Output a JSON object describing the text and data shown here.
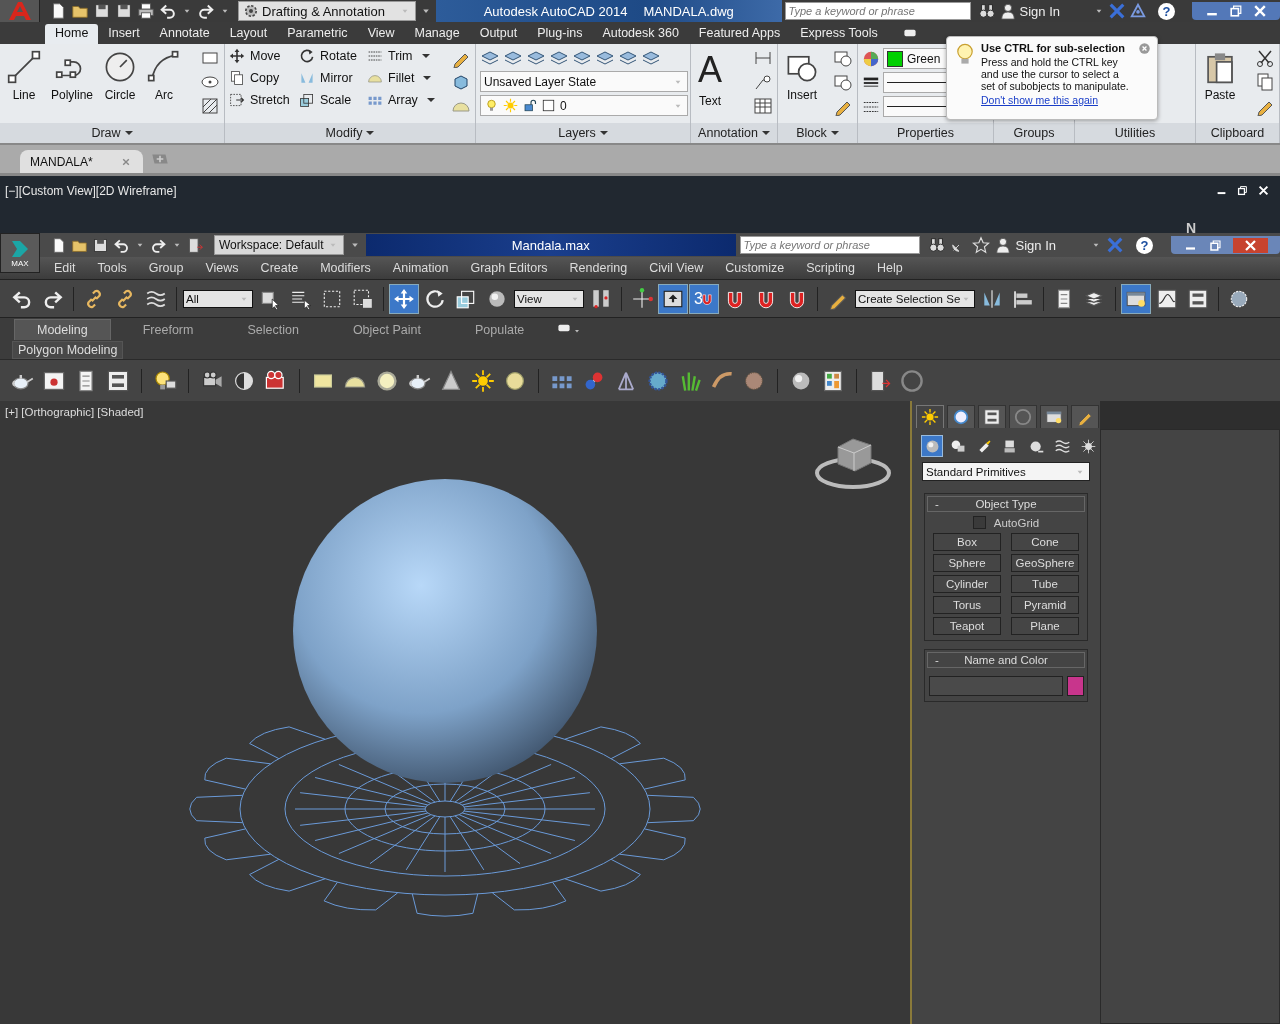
{
  "autocad": {
    "workspace": "Drafting & Annotation",
    "title": "Autodesk AutoCAD 2014",
    "filename": "MANDALA.dwg",
    "search": {
      "placeholder": "Type a keyword or phrase"
    },
    "sign_in": "Sign In",
    "help": "?",
    "ribbon_tabs": [
      {
        "label": "Home",
        "selected": true
      },
      {
        "label": "Insert",
        "selected": false
      },
      {
        "label": "Annotate",
        "selected": false
      },
      {
        "label": "Layout",
        "selected": false
      },
      {
        "label": "Parametric",
        "selected": false
      },
      {
        "label": "View",
        "selected": false
      },
      {
        "label": "Manage",
        "selected": false
      },
      {
        "label": "Output",
        "selected": false
      },
      {
        "label": "Plug-ins",
        "selected": false
      },
      {
        "label": "Autodesk 360",
        "selected": false
      },
      {
        "label": "Featured Apps",
        "selected": false
      },
      {
        "label": "Express Tools",
        "selected": false
      }
    ],
    "draw": {
      "title": "Draw",
      "tools": [
        "Line",
        "Polyline",
        "Circle",
        "Arc"
      ]
    },
    "modify": {
      "title": "Modify",
      "tools": [
        {
          "label": "Move",
          "menu": false
        },
        {
          "label": "Rotate",
          "menu": false
        },
        {
          "label": "Trim",
          "menu": true
        },
        {
          "label": "Copy",
          "menu": false
        },
        {
          "label": "Mirror",
          "menu": false
        },
        {
          "label": "Fillet",
          "menu": true
        },
        {
          "label": "Stretch",
          "menu": false
        },
        {
          "label": "Scale",
          "menu": false
        },
        {
          "label": "Array",
          "menu": true
        }
      ]
    },
    "layers": {
      "title": "Layers",
      "layer_state": "Unsaved Layer State",
      "current_layer": "0"
    },
    "annotation": {
      "title": "Annotation",
      "glyph": "A",
      "tool": "Text"
    },
    "block": {
      "title": "Block",
      "tool": "Insert"
    },
    "properties": {
      "title": "Properties",
      "color_name": "Green"
    },
    "groups": {
      "title": "Groups"
    },
    "utilities": {
      "title": "Utilities"
    },
    "clipboard": {
      "title": "Clipboard",
      "tool": "Paste"
    },
    "tooltip": {
      "title": "Use CTRL for sub-selection",
      "body": "Press and hold the CTRL key and use the cursor to select a set of subobjects to manipulate.",
      "link": "Don't show me this again"
    },
    "doc_tabs": [
      {
        "label": "MANDALA*",
        "selected": true
      }
    ],
    "viewport_label": "[−][Custom View][2D Wireframe]",
    "compass_label": "N"
  },
  "max": {
    "logo_label": "MAX",
    "workspace": "Workspace: Default",
    "title": "Mandala.max",
    "search": {
      "placeholder": "Type a keyword or phrase"
    },
    "sign_in": "Sign In",
    "help": "?",
    "menu": [
      "Edit",
      "Tools",
      "Group",
      "Views",
      "Create",
      "Modifiers",
      "Animation",
      "Graph Editors",
      "Rendering",
      "Civil View",
      "Customize",
      "Scripting",
      "Help"
    ],
    "selection_filter": "All",
    "reference_coord": "View",
    "snap": {
      "label": "3",
      "on": true
    },
    "named_selection": "Create Selection Se",
    "toolbar_buttons": [
      {
        "on": false
      },
      {
        "on": false
      },
      {
        "on": false
      },
      {
        "on": false
      },
      {
        "on": false
      },
      {
        "on": false
      },
      {
        "on": false
      },
      {
        "on": false
      },
      {
        "on": false
      },
      {
        "on": true
      },
      {
        "on": false
      },
      {
        "on": false
      },
      {
        "on": false
      },
      {
        "on": false
      },
      {
        "on": false
      },
      {
        "on": true
      },
      {
        "on": false
      },
      {
        "on": false
      },
      {
        "on": false
      },
      {
        "on": false
      },
      {
        "on": false
      },
      {
        "on": false
      },
      {
        "on": false
      },
      {
        "on": false
      },
      {
        "on": true
      },
      {
        "on": false
      },
      {
        "on": false
      },
      {
        "on": false
      }
    ],
    "ribbon_tabs": [
      {
        "label": "Modeling",
        "selected": true
      },
      {
        "label": "Freeform",
        "selected": false
      },
      {
        "label": "Selection",
        "selected": false
      },
      {
        "label": "Object Paint",
        "selected": false
      },
      {
        "label": "Populate",
        "selected": false
      }
    ],
    "ribbon_panel": "Polygon Modeling",
    "viewport_label": "[+] [Orthographic] [Shaded]",
    "command_panel": {
      "tabs": [
        {
          "selected": true
        },
        {
          "selected": false
        },
        {
          "selected": false
        },
        {
          "selected": false
        },
        {
          "selected": false
        },
        {
          "selected": false
        }
      ],
      "categories": [
        {
          "selected": true
        },
        {
          "selected": false
        },
        {
          "selected": false
        },
        {
          "selected": false
        },
        {
          "selected": false
        },
        {
          "selected": false
        },
        {
          "selected": false
        }
      ],
      "dropdown": "Standard Primitives",
      "object_type": {
        "toggle": "-",
        "title": "Object Type",
        "autogrid": {
          "label": "AutoGrid",
          "checked": false
        },
        "buttons": [
          "Box",
          "Cone",
          "Sphere",
          "GeoSphere",
          "Cylinder",
          "Tube",
          "Torus",
          "Pyramid",
          "Teapot",
          "Plane"
        ]
      },
      "name_and_color": {
        "toggle": "-",
        "title": "Name and Color",
        "color": "#c8358c"
      }
    }
  }
}
